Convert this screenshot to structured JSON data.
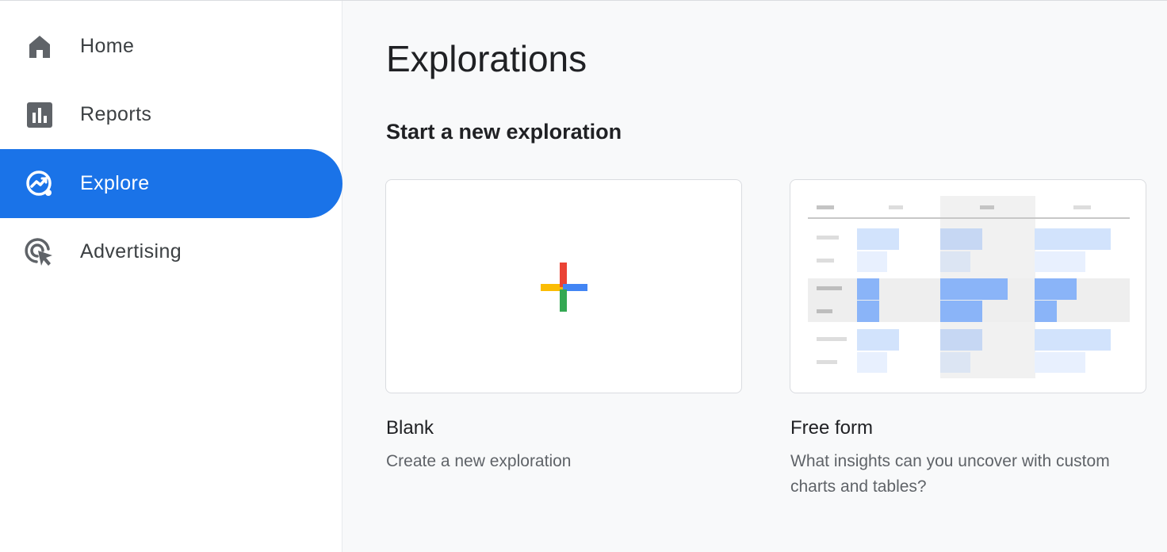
{
  "sidebar": {
    "items": [
      {
        "label": "Home",
        "icon": "home-icon",
        "active": false
      },
      {
        "label": "Reports",
        "icon": "reports-icon",
        "active": false
      },
      {
        "label": "Explore",
        "icon": "explore-icon",
        "active": true
      },
      {
        "label": "Advertising",
        "icon": "advertising-icon",
        "active": false
      }
    ]
  },
  "main": {
    "title": "Explorations",
    "section_title": "Start a new exploration",
    "cards": [
      {
        "name": "Blank",
        "description": "Create a new exploration",
        "preview": "plus-icon"
      },
      {
        "name": "Free form",
        "description": "What insights can you uncover with custom charts and tables?",
        "preview": "freeform-table-preview"
      }
    ]
  },
  "colors": {
    "accent": "#1a73e8",
    "icon_gray": "#5f6368",
    "google_red": "#ea4335",
    "google_blue": "#4285f4",
    "google_yellow": "#fbbc04",
    "google_green": "#34a853"
  }
}
